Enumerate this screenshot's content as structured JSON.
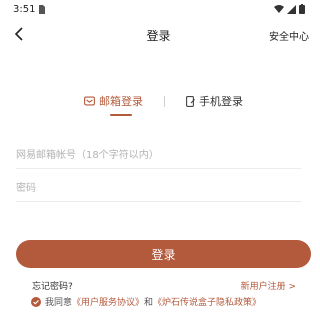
{
  "status_bar": {
    "time": "3:51",
    "icons": [
      "sim-card-icon",
      "wifi-icon",
      "signal-icon",
      "battery-icon"
    ]
  },
  "nav": {
    "title": "登录",
    "right_link": "安全中心",
    "back_icon": "chevron-left-icon"
  },
  "tabs": [
    {
      "label": "邮箱登录",
      "icon": "mail-icon",
      "active": true
    },
    {
      "label": "手机登录",
      "icon": "phone-icon",
      "active": false
    }
  ],
  "form": {
    "email_placeholder": "网易邮箱帐号（18个字符以内）",
    "email_value": "",
    "password_placeholder": "密码",
    "password_value": ""
  },
  "login_button_label": "登录",
  "forgot_password": "忘记密码?",
  "register": "新用户注册 >",
  "agreement": {
    "prefix": "我同意",
    "link1": "《用户服务协议》",
    "joiner": "和",
    "link2": "《炉石传说盒子隐私政策》",
    "checked": true
  },
  "colors": {
    "accent": "#b45a3c",
    "text": "#333333",
    "placeholder": "#b3b3b3"
  }
}
